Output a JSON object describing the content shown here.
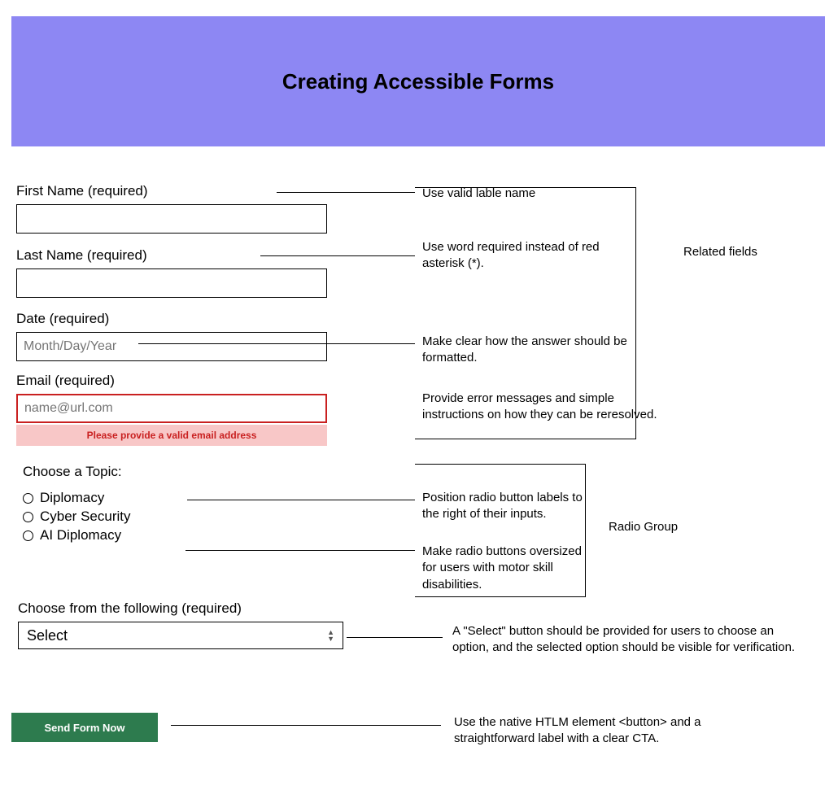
{
  "header": {
    "title": "Creating Accessible Forms"
  },
  "fields": {
    "first_name_label": "First Name (required)",
    "first_name_value": "",
    "last_name_label": "Last Name (required)",
    "last_name_value": "",
    "date_label": "Date (required)",
    "date_placeholder": "Month/Day/Year",
    "date_value": "",
    "email_label": "Email (required)",
    "email_placeholder": "name@url.com",
    "email_value": "",
    "email_error": "Please provide a valid email address",
    "topic_label": "Choose a Topic:",
    "radio1": "Diplomacy",
    "radio2": "Cyber Security",
    "radio3": "AI Diplomacy",
    "select_label": "Choose from the following (required)",
    "select_value": "Select",
    "submit_label": "Send Form Now"
  },
  "annotations": {
    "valid_label": "Use valid lable name",
    "required_word": "Use word required instead of red asterisk (*).",
    "related_fields": "Related fields",
    "format_clear": "Make clear how the answer should be formatted.",
    "error_msg": "Provide error messages and simple instructions on how they can be reresolved.",
    "radio_position": "Position radio button labels to the right of their inputs.",
    "radio_group": "Radio Group",
    "radio_oversized": "Make radio buttons oversized for users with motor skill disabilities.",
    "select_note": "A \"Select\" button should be provided for users to choose an option, and the selected option should be visible for verification.",
    "button_note": "Use the native HTLM element <button> and a straightforward label with a clear CTA."
  }
}
